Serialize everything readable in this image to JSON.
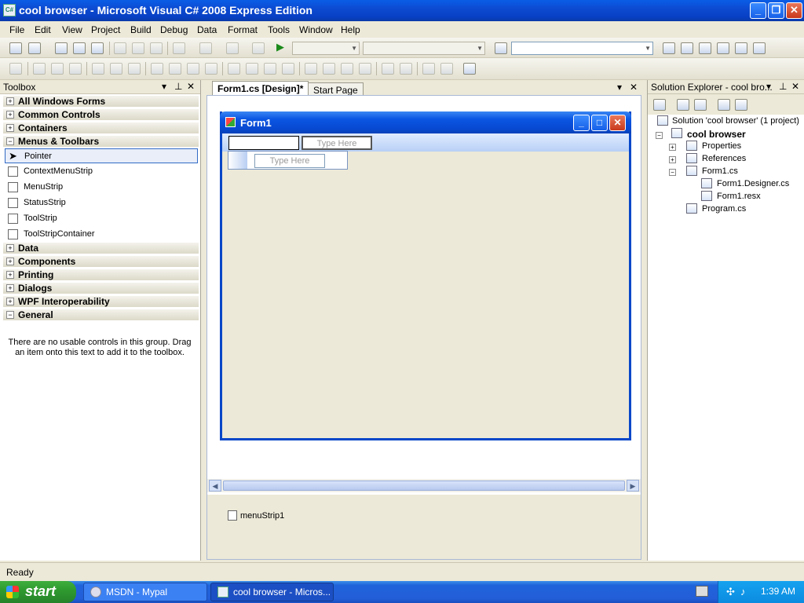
{
  "window": {
    "title": "cool browser - Microsoft Visual C# 2008 Express Edition",
    "icon_text": "C#"
  },
  "menu": [
    "File",
    "Edit",
    "View",
    "Project",
    "Build",
    "Debug",
    "Data",
    "Format",
    "Tools",
    "Window",
    "Help"
  ],
  "toolbox": {
    "title": "Toolbox",
    "groups": [
      "All Windows Forms",
      "Common Controls",
      "Containers",
      "Menus & Toolbars",
      "Data",
      "Components",
      "Printing",
      "Dialogs",
      "WPF Interoperability",
      "General"
    ],
    "menus_toolbars_items": [
      "Pointer",
      "ContextMenuStrip",
      "MenuStrip",
      "StatusStrip",
      "ToolStrip",
      "ToolStripContainer"
    ],
    "general_empty_text": "There are no usable controls in this group. Drag an item onto this text to add it to the toolbox."
  },
  "doc_tabs": {
    "active": "Form1.cs [Design]*",
    "inactive": "Start Page"
  },
  "designer": {
    "form_title": "Form1",
    "type_here_top": "Type Here",
    "type_here_dropdown": "Type Here",
    "tray_component": "menuStrip1"
  },
  "solution_explorer": {
    "title": "Solution Explorer - cool bro...",
    "solution": "Solution 'cool browser' (1 project)",
    "project": "cool browser",
    "nodes": [
      "Properties",
      "References",
      "Form1.cs",
      "Form1.Designer.cs",
      "Form1.resx",
      "Program.cs"
    ]
  },
  "status": "Ready",
  "taskbar": {
    "start": "start",
    "items": [
      "MSDN - Mypal",
      "cool browser - Micros..."
    ],
    "clock": "1:39 AM"
  }
}
